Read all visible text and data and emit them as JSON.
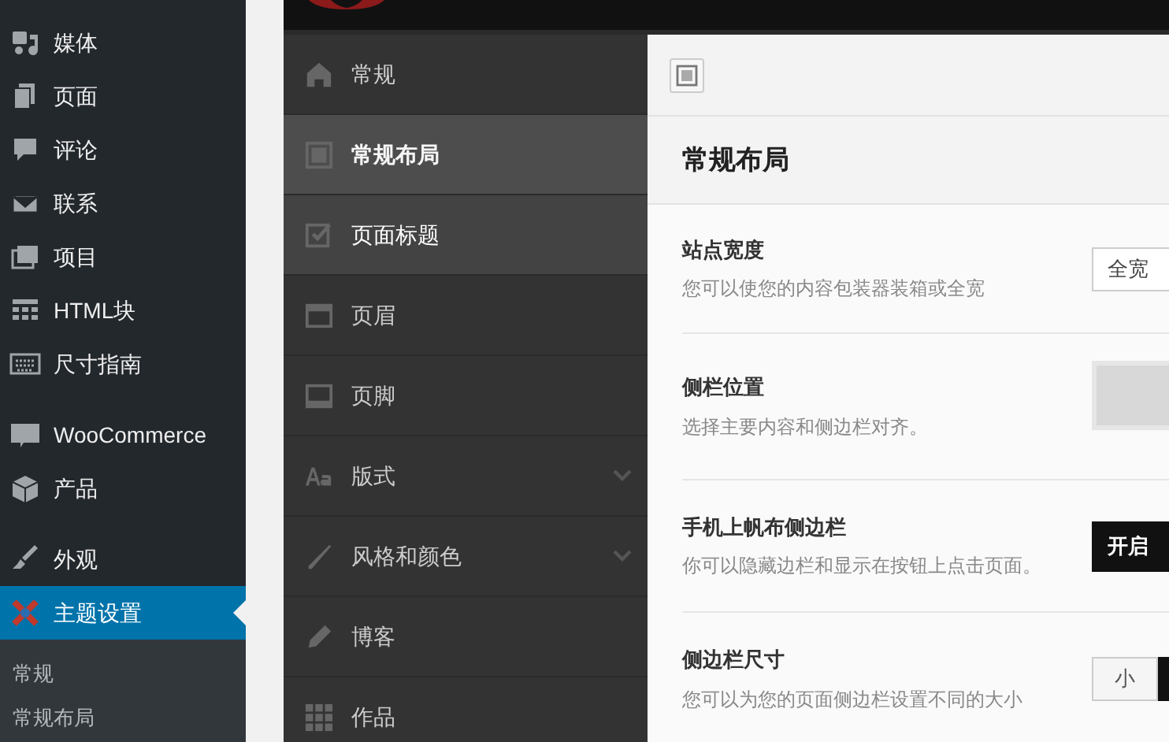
{
  "admin_menu": {
    "groups": [
      [
        {
          "label": "媒体",
          "selected": false
        },
        {
          "label": "页面",
          "selected": false
        },
        {
          "label": "评论",
          "selected": false
        },
        {
          "label": "联系",
          "selected": false
        },
        {
          "label": "项目",
          "selected": false
        },
        {
          "label": "HTML块",
          "selected": false
        },
        {
          "label": "尺寸指南",
          "selected": false
        }
      ],
      [
        {
          "label": "WooCommerce",
          "selected": false
        },
        {
          "label": "产品",
          "selected": false
        }
      ],
      [
        {
          "label": "外观",
          "selected": false
        },
        {
          "label": "主题设置",
          "selected": true
        }
      ]
    ],
    "submenu": [
      {
        "label": "常规",
        "selected": false
      },
      {
        "label": "常规布局",
        "selected": false
      }
    ]
  },
  "theme_nav": {
    "items": [
      {
        "label": "常规",
        "selected": false,
        "hovered": false,
        "expandable": false
      },
      {
        "label": "常规布局",
        "selected": true,
        "hovered": false,
        "expandable": false
      },
      {
        "label": "页面标题",
        "selected": false,
        "hovered": true,
        "expandable": false
      },
      {
        "label": "页眉",
        "selected": false,
        "hovered": false,
        "expandable": false
      },
      {
        "label": "页脚",
        "selected": false,
        "hovered": false,
        "expandable": false
      },
      {
        "label": "版式",
        "selected": false,
        "hovered": false,
        "expandable": true
      },
      {
        "label": "风格和颜色",
        "selected": false,
        "hovered": false,
        "expandable": true
      },
      {
        "label": "博客",
        "selected": false,
        "hovered": false,
        "expandable": false
      },
      {
        "label": "作品",
        "selected": false,
        "hovered": false,
        "expandable": false
      }
    ]
  },
  "panel": {
    "title": "常规布局",
    "settings": [
      {
        "label": "站点宽度",
        "description": "您可以使您的内容包装器装箱或全宽",
        "kind": "select",
        "value": "全宽"
      },
      {
        "label": "侧栏位置",
        "description": "选择主要内容和侧边栏对齐。",
        "kind": "picker"
      },
      {
        "label": "手机上帆布侧边栏",
        "description": "你可以隐藏边栏和显示在按钮上点击页面。",
        "kind": "toggle",
        "value": "开启",
        "on": true
      },
      {
        "label": "侧边栏尺寸",
        "description": "您可以为您的页面侧边栏设置不同的大小",
        "kind": "segmented",
        "options": [
          {
            "label": "小",
            "selected": false
          },
          {
            "selected": true
          }
        ]
      }
    ]
  }
}
